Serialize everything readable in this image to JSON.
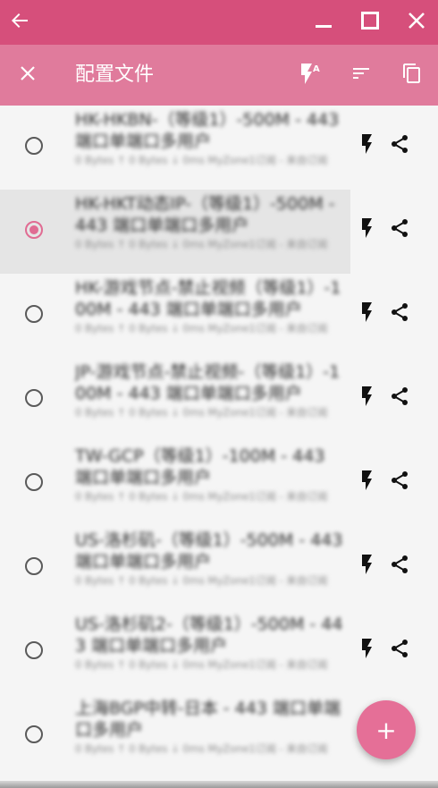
{
  "window": {
    "back_icon": "arrow-left-icon",
    "minimize_icon": "minimize-icon",
    "maximize_icon": "maximize-icon",
    "close_icon": "close-icon"
  },
  "appbar": {
    "close_icon": "close-icon",
    "title": "配置文件",
    "auto_select_icon": "flash-auto-icon",
    "sort_icon": "sort-icon",
    "copy_icon": "copy-icon"
  },
  "profiles": [
    {
      "name": "HK-HKBN-（等级1）-500M - 443 端口单端口多用户",
      "stats": "0 Bytes ↑  0 Bytes ↓  0ms   MyZone1订阅 - 来自订阅",
      "selected": false
    },
    {
      "name": "HK-HKT动态IP-（等级1）-500M - 443 端口单端口多用户",
      "stats": "0 Bytes ↑  0 Bytes ↓  0ms   MyZone1订阅 - 来自订阅",
      "selected": true
    },
    {
      "name": "HK-游戏节点-禁止视频（等级1）-100M - 443 端口单端口多用户",
      "stats": "0 Bytes ↑  0 Bytes ↓  0ms   MyZone1订阅 - 来自订阅",
      "selected": false
    },
    {
      "name": "JP-游戏节点-禁止视频-（等级1）-100M - 443 端口单端口多用户",
      "stats": "0 Bytes ↑  0 Bytes ↓  0ms   MyZone1订阅 - 来自订阅",
      "selected": false
    },
    {
      "name": "TW-GCP（等级1）-100M - 443 端口单端口多用户",
      "stats": "0 Bytes ↑  0 Bytes ↓  0ms   MyZone1订阅 - 来自订阅",
      "selected": false
    },
    {
      "name": "US-洛杉矶-（等级1）-500M - 443 端口单端口多用户",
      "stats": "0 Bytes ↑  0 Bytes ↓  0ms   MyZone1订阅 - 来自订阅",
      "selected": false
    },
    {
      "name": "US-洛杉矶2-（等级1）-500M - 443 端口单端口多用户",
      "stats": "0 Bytes ↑  0 Bytes ↓  0ms   MyZone1订阅 - 来自订阅",
      "selected": false
    },
    {
      "name": "上海BGP中转-日本 - 443 端口单端口多用户",
      "stats": "0 Bytes ↑  0 Bytes ↓  0ms   MyZone1订阅 - 来自订阅",
      "selected": false
    }
  ],
  "row_icons": {
    "flash": "flash-icon",
    "share": "share-icon"
  },
  "fab": {
    "label": "+",
    "icon": "add-icon"
  },
  "colors": {
    "titlebar": "#d64f7b",
    "appbar": "#e07b9c",
    "accent": "#e06c93",
    "selected_row": "#e5e5e5",
    "background": "#f5f5f5"
  }
}
